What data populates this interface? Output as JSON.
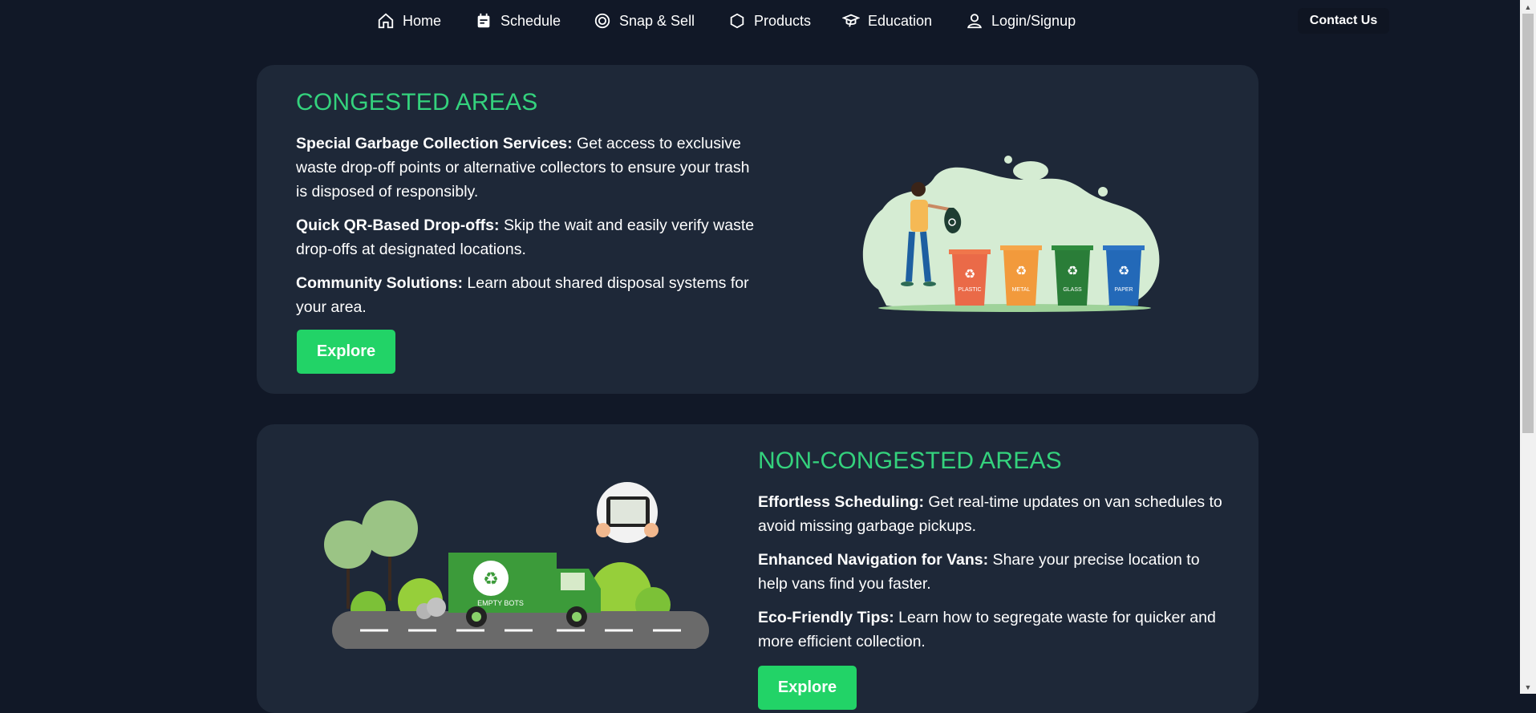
{
  "nav": {
    "items": [
      {
        "label": "Home",
        "icon": "home-icon"
      },
      {
        "label": "Schedule",
        "icon": "calendar-icon"
      },
      {
        "label": "Snap & Sell",
        "icon": "camera-icon"
      },
      {
        "label": "Products",
        "icon": "hexagon-icon"
      },
      {
        "label": "Education",
        "icon": "graduation-cap-icon"
      },
      {
        "label": "Login/Signup",
        "icon": "user-icon"
      }
    ],
    "contact_label": "Contact Us"
  },
  "congested": {
    "title": "CONGESTED AREAS",
    "points": [
      {
        "heading": "Special Garbage Collection Services:",
        "text": " Get access to exclusive waste drop-off points or alternative collectors to ensure your trash is disposed of responsibly."
      },
      {
        "heading": "Quick QR-Based Drop-offs:",
        "text": " Skip the wait and easily verify waste drop-offs at designated locations."
      },
      {
        "heading": "Community Solutions:",
        "text": " Learn about shared disposal systems for your area."
      }
    ],
    "button_label": "Explore",
    "bin_labels": [
      "PLASTIC",
      "METAL",
      "GLASS",
      "PAPER"
    ]
  },
  "non_congested": {
    "title": "NON-CONGESTED AREAS",
    "points": [
      {
        "heading": "Effortless Scheduling:",
        "text": " Get real-time updates on van schedules to avoid missing garbage pickups."
      },
      {
        "heading": "Enhanced Navigation for Vans:",
        "text": " Share your precise location to help vans find you faster."
      },
      {
        "heading": "Eco-Friendly Tips:",
        "text": " Learn how to segregate waste for quicker and more efficient collection."
      }
    ],
    "button_label": "Explore",
    "truck_label": "EMPTY BOTS"
  },
  "colors": {
    "background": "#111827",
    "card": "#1e2838",
    "accent": "#34d27d",
    "button": "#22d367"
  }
}
